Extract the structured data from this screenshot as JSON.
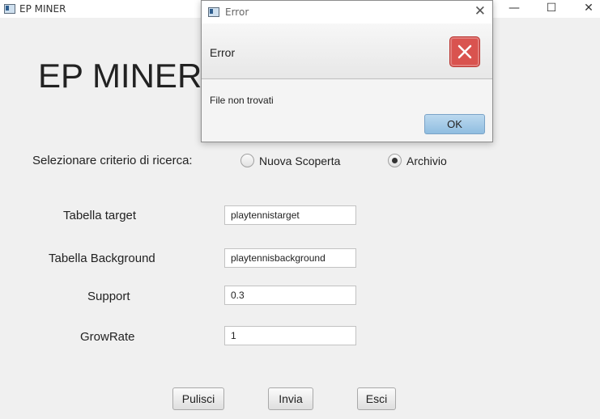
{
  "window": {
    "title": "EP MINER",
    "minimize_glyph": "—",
    "maximize_glyph": "☐",
    "close_glyph": "✕"
  },
  "app": {
    "heading": "EP MINER",
    "criteria_label": "Selezionare criterio di ricerca:",
    "radio_options": [
      {
        "label": "Nuova Scoperta",
        "checked": false
      },
      {
        "label": "Archivio",
        "checked": true
      }
    ],
    "fields": {
      "target": {
        "label": "Tabella target",
        "value": "playtennistarget"
      },
      "background": {
        "label": "Tabella Background",
        "value": "playtennisbackground"
      },
      "support": {
        "label": "Support",
        "value": "0.3"
      },
      "growrate": {
        "label": "GrowRate",
        "value": "1"
      }
    },
    "buttons": {
      "clear": "Pulisci",
      "send": "Invia",
      "exit": "Esci"
    }
  },
  "dialog": {
    "title": "Error",
    "close_glyph": "✕",
    "header": "Error",
    "content": "File non trovati",
    "ok": "OK",
    "icon": "error-icon",
    "accent": "#d9534f"
  }
}
